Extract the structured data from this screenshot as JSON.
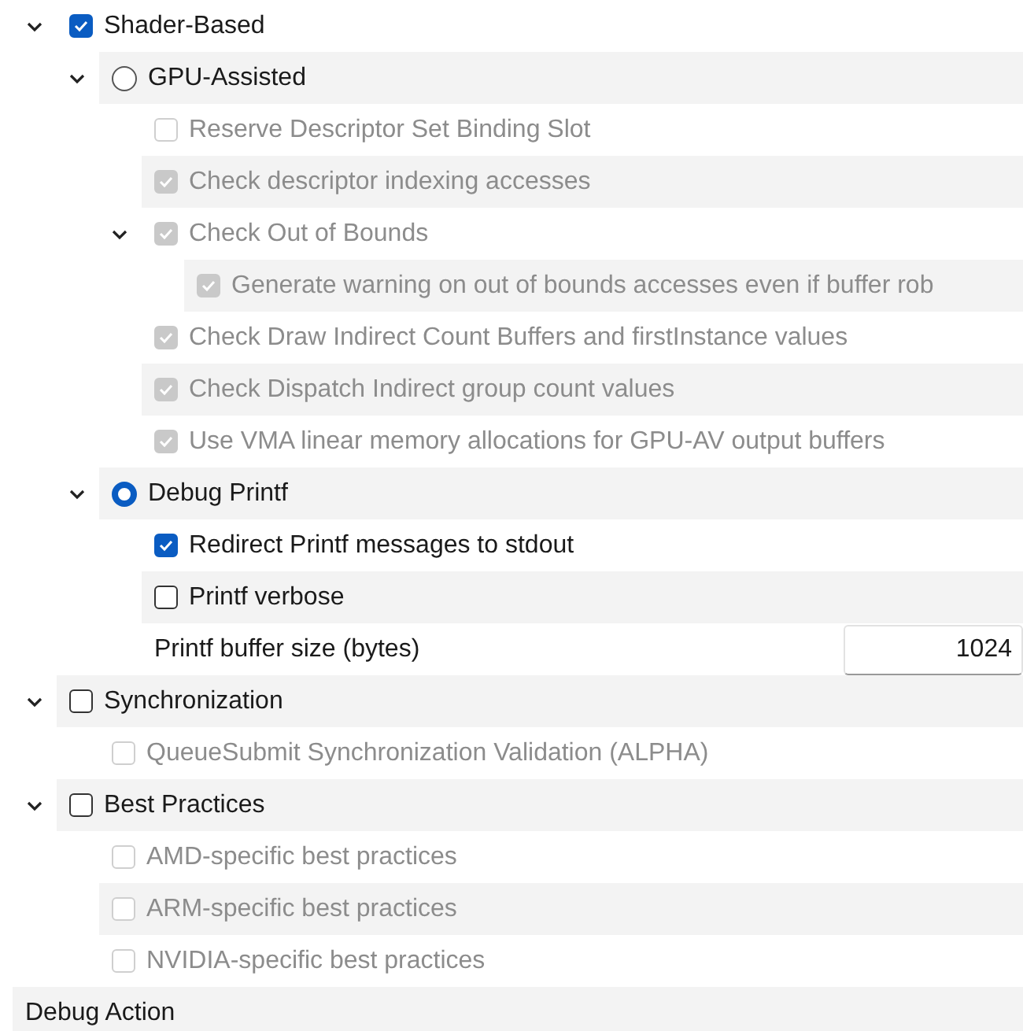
{
  "tree": [
    {
      "kind": "checkbox",
      "label": "Shader-Based",
      "checked": true,
      "disabled": false,
      "expanded": true,
      "children": [
        {
          "kind": "radio",
          "label": "GPU-Assisted",
          "selected": false,
          "disabled": false,
          "expanded": true,
          "children": [
            {
              "kind": "checkbox",
              "label": "Reserve Descriptor Set Binding Slot",
              "checked": false,
              "disabled": true
            },
            {
              "kind": "checkbox",
              "label": "Check descriptor indexing accesses",
              "checked": true,
              "disabled": true
            },
            {
              "kind": "checkbox",
              "label": "Check Out of Bounds",
              "checked": true,
              "disabled": true,
              "expanded": true,
              "children": [
                {
                  "kind": "checkbox",
                  "label": "Generate warning on out of bounds accesses even if buffer rob",
                  "checked": true,
                  "disabled": true
                }
              ]
            },
            {
              "kind": "checkbox",
              "label": "Check Draw Indirect Count Buffers and firstInstance values",
              "checked": true,
              "disabled": true
            },
            {
              "kind": "checkbox",
              "label": "Check Dispatch Indirect group count values",
              "checked": true,
              "disabled": true
            },
            {
              "kind": "checkbox",
              "label": "Use VMA linear memory allocations for GPU-AV output buffers",
              "checked": true,
              "disabled": true
            }
          ]
        },
        {
          "kind": "radio",
          "label": "Debug Printf",
          "selected": true,
          "disabled": false,
          "expanded": true,
          "children": [
            {
              "kind": "checkbox",
              "label": "Redirect Printf messages to stdout",
              "checked": true,
              "disabled": false
            },
            {
              "kind": "checkbox",
              "label": "Printf verbose",
              "checked": false,
              "disabled": false
            },
            {
              "kind": "number",
              "label": "Printf buffer size (bytes)",
              "value": "1024"
            }
          ]
        }
      ]
    },
    {
      "kind": "checkbox",
      "label": "Synchronization",
      "checked": false,
      "disabled": false,
      "expanded": true,
      "children": [
        {
          "kind": "checkbox",
          "label": "QueueSubmit Synchronization Validation (ALPHA)",
          "checked": false,
          "disabled": true
        }
      ]
    },
    {
      "kind": "checkbox",
      "label": "Best Practices",
      "checked": false,
      "disabled": false,
      "expanded": true,
      "children": [
        {
          "kind": "checkbox",
          "label": "AMD-specific best practices",
          "checked": false,
          "disabled": true
        },
        {
          "kind": "checkbox",
          "label": "ARM-specific best practices",
          "checked": false,
          "disabled": true
        },
        {
          "kind": "checkbox",
          "label": "NVIDIA-specific best practices",
          "checked": false,
          "disabled": true
        }
      ]
    },
    {
      "kind": "section",
      "label": "Debug Action"
    }
  ]
}
